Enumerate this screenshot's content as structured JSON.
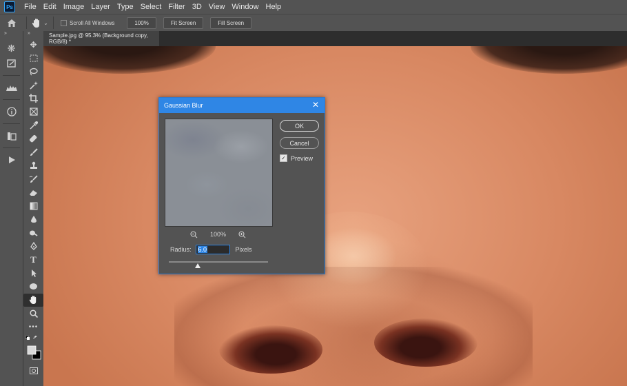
{
  "app": {
    "logo_text": "Ps"
  },
  "menu": [
    "File",
    "Edit",
    "Image",
    "Layer",
    "Type",
    "Select",
    "Filter",
    "3D",
    "View",
    "Window",
    "Help"
  ],
  "options_bar": {
    "scroll_all_windows": "Scroll All Windows",
    "zoom_btn": "100%",
    "fit_screen": "Fit Screen",
    "fill_screen": "Fill Screen"
  },
  "dock": {
    "collapse": "»"
  },
  "tools": {
    "collapse": "»"
  },
  "document": {
    "tab_title": "Sample.jpg @ 95.3% (Background copy, RGB/8) *"
  },
  "dialog": {
    "title": "Gaussian Blur",
    "ok": "OK",
    "cancel": "Cancel",
    "preview_label": "Preview",
    "preview_checked": true,
    "zoom_level": "100%",
    "radius_label": "Radius:",
    "radius_value": "6.0",
    "radius_unit": "Pixels",
    "slider_fraction": 0.29
  },
  "colors": {
    "accent": "#2f86e5",
    "panel": "#535353",
    "skin": "#e09a76"
  }
}
